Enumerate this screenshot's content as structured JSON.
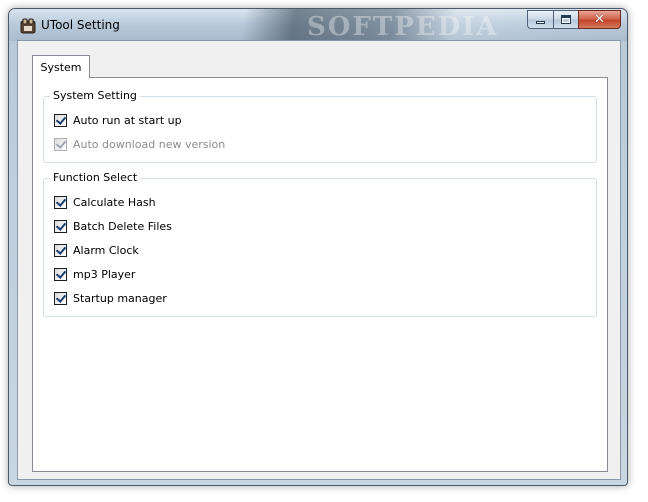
{
  "window": {
    "title": "UTool Setting",
    "brand_watermark": "SOFTPEDIA"
  },
  "controls": {
    "minimize": "minimize-icon",
    "maximize": "maximize-icon",
    "close": "close-icon",
    "close_glyph": "✕"
  },
  "tabs": [
    {
      "label": "System",
      "selected": true
    }
  ],
  "system_setting": {
    "title": "System Setting",
    "options": [
      {
        "label": "Auto run at start up",
        "checked": true,
        "enabled": true
      },
      {
        "label": "Auto download new version",
        "checked": true,
        "enabled": false
      }
    ]
  },
  "function_select": {
    "title": "Function Select",
    "options": [
      {
        "label": "Calculate Hash",
        "checked": true
      },
      {
        "label": "Batch Delete Files",
        "checked": true
      },
      {
        "label": "Alarm Clock",
        "checked": true
      },
      {
        "label": "mp3 Player",
        "checked": true
      },
      {
        "label": "Startup manager",
        "checked": true
      }
    ]
  },
  "colors": {
    "close_button": "#c2442a",
    "panel_background": "#ffffff",
    "client_background": "#f0f0f0"
  }
}
